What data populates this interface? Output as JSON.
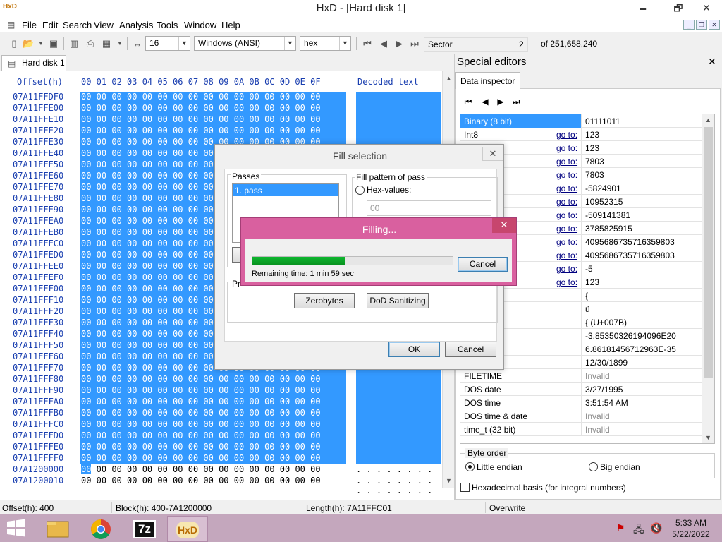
{
  "window": {
    "title": "HxD - [Hard disk 1]",
    "minimize": "🗕",
    "restore": "🗗",
    "close": "✕"
  },
  "menu": [
    "File",
    "Edit",
    "Search",
    "View",
    "Analysis",
    "Tools",
    "Window",
    "Help"
  ],
  "toolbar": {
    "bytes_per_row": "16",
    "charset": "Windows (ANSI)",
    "display_mode": "hex",
    "nav_unit": "Sector",
    "sector_value": "2",
    "sector_total": "of 251,658,240"
  },
  "editor_tab": "Hard disk 1",
  "hex": {
    "offset_header": "Offset(h)",
    "byte_header": "00 01 02 03 04 05 06 07 08 09 0A 0B 0C 0D 0E 0F",
    "decoded_header": "Decoded text",
    "zero_bytes": "00 00 00 00 00 00 00 00 00 00 00 00 00 00 00 00",
    "rows": [
      "07A11FFDF0",
      "07A11FFE00",
      "07A11FFE10",
      "07A11FFE20",
      "07A11FFE30",
      "07A11FFE40",
      "07A11FFE50",
      "07A11FFE60",
      "07A11FFE70",
      "07A11FFE80",
      "07A11FFE90",
      "07A11FFEA0",
      "07A11FFEB0",
      "07A11FFEC0",
      "07A11FFED0",
      "07A11FFEE0",
      "07A11FFEF0",
      "07A11FFF00",
      "07A11FFF10",
      "07A11FFF20",
      "07A11FFF30",
      "07A11FFF40",
      "07A11FFF50",
      "07A11FFF60",
      "07A11FFF70",
      "07A11FFF80",
      "07A11FFF90",
      "07A11FFFA0",
      "07A11FFFB0",
      "07A11FFFC0",
      "07A11FFFD0",
      "07A11FFFE0",
      "07A11FFFF0"
    ],
    "tail_rows": [
      {
        "offset": "07A1200000",
        "first": "00",
        "rest": " 00 00 00 00 00 00 00 00 00 00 00 00 00 00 00",
        "decoded": ". . . . . . . . . . . . . . . ."
      },
      {
        "offset": "07A1200010",
        "first": "",
        "rest": "00 00 00 00 00 00 00 00 00 00 00 00 00 00 00 00",
        "decoded": ". . . . . . . . . . . . . . . ."
      }
    ]
  },
  "special": {
    "title": "Special editors",
    "tab": "Data inspector",
    "goto": "go to:",
    "rows": [
      {
        "name": "Binary (8 bit)",
        "value": "01111011",
        "goto": false,
        "hl": true
      },
      {
        "name": "Int8",
        "value": "123",
        "goto": true
      },
      {
        "name": "",
        "value": "123",
        "goto": true
      },
      {
        "name": "",
        "value": "7803",
        "goto": true
      },
      {
        "name": "",
        "value": "7803",
        "goto": true
      },
      {
        "name": "",
        "value": "-5824901",
        "goto": true
      },
      {
        "name": "",
        "value": "10952315",
        "goto": true
      },
      {
        "name": "",
        "value": "-509141381",
        "goto": true
      },
      {
        "name": "",
        "value": "3785825915",
        "goto": true
      },
      {
        "name": "",
        "value": "4095686735716359803",
        "goto": true
      },
      {
        "name": "",
        "value": "4095686735716359803",
        "goto": true
      },
      {
        "name": "",
        "value": "-5",
        "goto": true
      },
      {
        "name": "",
        "value": "123",
        "goto": true
      },
      {
        "name": "char8_t",
        "value": "{",
        "goto": false
      },
      {
        "name": "char16_t",
        "value": "ű",
        "goto": false
      },
      {
        "name": "point",
        "value": "{ (U+007B)",
        "goto": false
      },
      {
        "name": "32)",
        "value": "-3.85350326194096E20",
        "goto": false
      },
      {
        "name": "at64)",
        "value": "6.86181456712963E-35",
        "goto": false
      },
      {
        "name": "",
        "value": "12/30/1899",
        "goto": false
      },
      {
        "name": "FILETIME",
        "value": "Invalid",
        "goto": false,
        "invalid": true
      },
      {
        "name": "DOS date",
        "value": "3/27/1995",
        "goto": false
      },
      {
        "name": "DOS time",
        "value": "3:51:54 AM",
        "goto": false
      },
      {
        "name": "DOS time & date",
        "value": "Invalid",
        "goto": false,
        "invalid": true
      },
      {
        "name": "time_t (32 bit)",
        "value": "Invalid",
        "goto": false,
        "invalid": true
      }
    ],
    "byte_order_label": "Byte order",
    "little_endian": "Little endian",
    "big_endian": "Big endian",
    "hex_basis": "Hexadecimal basis (for integral numbers)"
  },
  "status": {
    "offset": "Offset(h): 400",
    "block": "Block(h): 400-7A1200000",
    "length": "Length(h): 7A11FFC01",
    "mode": "Overwrite"
  },
  "fill_dialog": {
    "title": "Fill selection",
    "passes_label": "Passes",
    "pass_item": "1. pass",
    "pattern_label": "Fill pattern of pass",
    "hex_values_label": "Hex-values:",
    "hex_placeholder": "00",
    "presets_label": "Pr",
    "zerobytes": "Zerobytes",
    "dod": "DoD Sanitizing",
    "ok": "OK",
    "cancel": "Cancel"
  },
  "filling_dialog": {
    "title": "Filling...",
    "remaining": "Remaining time: 1 min 59 sec",
    "cancel": "Cancel",
    "progress": 0.46
  },
  "taskbar": {
    "time": "5:33 AM",
    "date": "5/22/2022",
    "sevenzip": "7z",
    "hxd": "HxD"
  },
  "colors": {
    "selection": "#3399ff",
    "accent": "#d9609f",
    "progress": "#0fb730"
  }
}
